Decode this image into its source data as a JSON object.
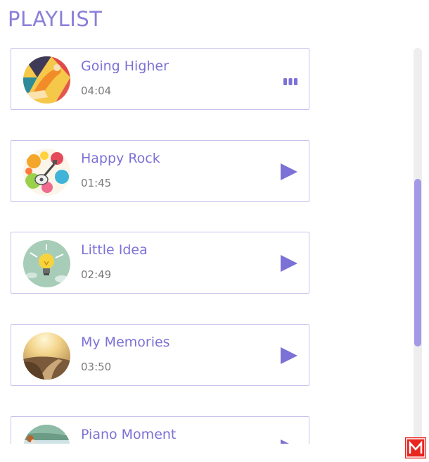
{
  "header": {
    "title": "PLAYLIST"
  },
  "playlist": [
    {
      "title": "Going Higher",
      "duration": "04:04",
      "state": "playing",
      "cover_icon": "abstract-runner-cover"
    },
    {
      "title": "Happy Rock",
      "duration": "01:45",
      "state": "paused",
      "cover_icon": "guitar-splash-cover"
    },
    {
      "title": "Little Idea",
      "duration": "02:49",
      "state": "paused",
      "cover_icon": "lightbulb-cover"
    },
    {
      "title": "My Memories",
      "duration": "03:50",
      "state": "paused",
      "cover_icon": "road-sunset-cover"
    },
    {
      "title": "Piano Moment",
      "duration": "",
      "state": "paused",
      "cover_icon": "piano-scene-cover"
    }
  ],
  "colors": {
    "accent": "#7c71d6",
    "title": "#8a7fd8",
    "border": "#c7c2ec",
    "scroll_thumb": "#a29ae6",
    "badge": "#e8251f"
  }
}
